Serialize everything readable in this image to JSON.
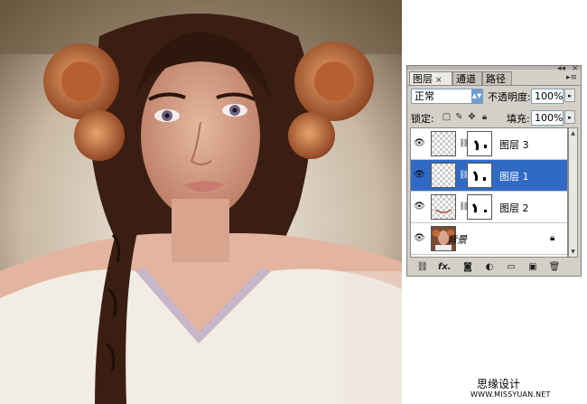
{
  "panel": {
    "tabs": [
      {
        "label": "图层",
        "close": "×"
      },
      {
        "label": "通道"
      },
      {
        "label": "路径"
      }
    ],
    "blend_mode": "正常",
    "opacity_label": "不透明度:",
    "opacity_value": "100%",
    "lock_label": "锁定:",
    "fill_label": "填充:",
    "fill_value": "100%",
    "layers": [
      {
        "name": "图层 3",
        "selected": false
      },
      {
        "name": "图层 1",
        "selected": true
      },
      {
        "name": "图层 2",
        "selected": false
      },
      {
        "name": "背景",
        "selected": false
      }
    ],
    "bottom_icons": [
      "link-icon",
      "fx-icon",
      "mask-icon",
      "adjustment-icon",
      "folder-icon",
      "new-layer-icon",
      "trash-icon"
    ],
    "bottom_fx": "fx."
  },
  "watermark": {
    "line1": "思缘设计",
    "line2": "WWW.MISSYUAN.NET"
  },
  "colors": {
    "selected_layer": "#316ac5",
    "panel_bg": "#d4d0c8"
  }
}
